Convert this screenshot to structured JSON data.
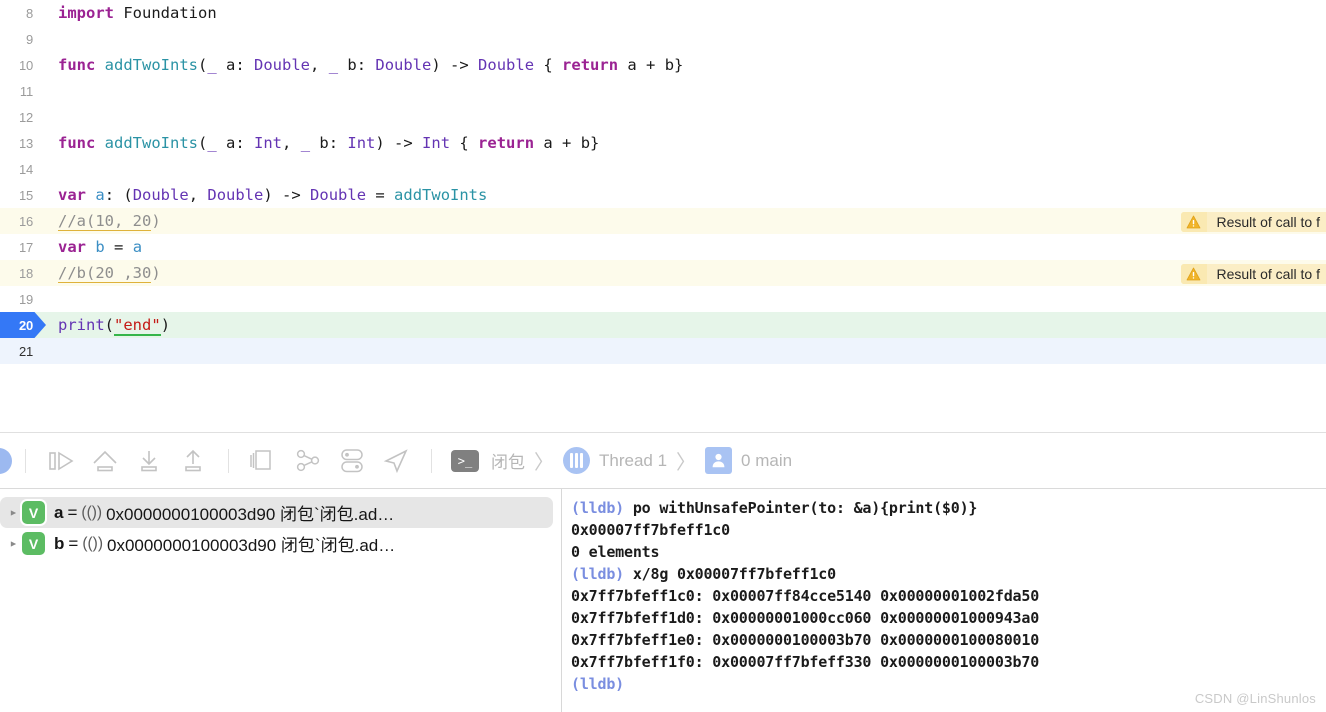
{
  "editor": {
    "lines": [
      {
        "num": "8",
        "state": "none",
        "tokens": [
          {
            "t": "kw",
            "v": "import"
          },
          {
            "t": "plain",
            "v": " Foundation"
          }
        ]
      },
      {
        "num": "9",
        "state": "none",
        "tokens": []
      },
      {
        "num": "10",
        "state": "none",
        "tokens": [
          {
            "t": "kw",
            "v": "func"
          },
          {
            "t": "plain",
            "v": " "
          },
          {
            "t": "fn",
            "v": "addTwoInts"
          },
          {
            "t": "plain",
            "v": "("
          },
          {
            "t": "pl",
            "v": "_"
          },
          {
            "t": "plain",
            "v": " a: "
          },
          {
            "t": "type",
            "v": "Double"
          },
          {
            "t": "plain",
            "v": ", "
          },
          {
            "t": "pl",
            "v": "_"
          },
          {
            "t": "plain",
            "v": " b: "
          },
          {
            "t": "type",
            "v": "Double"
          },
          {
            "t": "plain",
            "v": ") -> "
          },
          {
            "t": "type",
            "v": "Double"
          },
          {
            "t": "plain",
            "v": " { "
          },
          {
            "t": "kw",
            "v": "return"
          },
          {
            "t": "plain",
            "v": " a + b}"
          }
        ]
      },
      {
        "num": "11",
        "state": "none",
        "tokens": []
      },
      {
        "num": "12",
        "state": "none",
        "tokens": []
      },
      {
        "num": "13",
        "state": "none",
        "tokens": [
          {
            "t": "kw",
            "v": "func"
          },
          {
            "t": "plain",
            "v": " "
          },
          {
            "t": "fn",
            "v": "addTwoInts"
          },
          {
            "t": "plain",
            "v": "("
          },
          {
            "t": "pl",
            "v": "_"
          },
          {
            "t": "plain",
            "v": " a: "
          },
          {
            "t": "type",
            "v": "Int"
          },
          {
            "t": "plain",
            "v": ", "
          },
          {
            "t": "pl",
            "v": "_"
          },
          {
            "t": "plain",
            "v": " b: "
          },
          {
            "t": "type",
            "v": "Int"
          },
          {
            "t": "plain",
            "v": ") -> "
          },
          {
            "t": "type",
            "v": "Int"
          },
          {
            "t": "plain",
            "v": " { "
          },
          {
            "t": "kw",
            "v": "return"
          },
          {
            "t": "plain",
            "v": " a + b}"
          }
        ]
      },
      {
        "num": "14",
        "state": "none",
        "tokens": []
      },
      {
        "num": "15",
        "state": "none",
        "tokens": [
          {
            "t": "kw",
            "v": "var"
          },
          {
            "t": "plain",
            "v": " "
          },
          {
            "t": "var-nm",
            "v": "a"
          },
          {
            "t": "plain",
            "v": ": ("
          },
          {
            "t": "type",
            "v": "Double"
          },
          {
            "t": "plain",
            "v": ", "
          },
          {
            "t": "type",
            "v": "Double"
          },
          {
            "t": "plain",
            "v": ") -> "
          },
          {
            "t": "type",
            "v": "Double"
          },
          {
            "t": "plain",
            "v": " = "
          },
          {
            "t": "fn",
            "v": "addTwoInts"
          }
        ]
      },
      {
        "num": "16",
        "state": "warn",
        "tokens": [
          {
            "t": "cmt cmt-ul",
            "v": "//a(10, 20"
          },
          {
            "t": "cmt",
            "v": ")"
          }
        ],
        "warning": "Result of call to f"
      },
      {
        "num": "17",
        "state": "none",
        "tokens": [
          {
            "t": "kw",
            "v": "var"
          },
          {
            "t": "plain",
            "v": " "
          },
          {
            "t": "var-nm",
            "v": "b"
          },
          {
            "t": "plain",
            "v": " = "
          },
          {
            "t": "var-nm",
            "v": "a"
          }
        ]
      },
      {
        "num": "18",
        "state": "warn",
        "tokens": [
          {
            "t": "cmt cmt-ul",
            "v": "//b(20 ,30"
          },
          {
            "t": "cmt",
            "v": ")"
          }
        ],
        "warning": "Result of call to f"
      },
      {
        "num": "19",
        "state": "none",
        "tokens": []
      },
      {
        "num": "20",
        "state": "exec",
        "tokens": [
          {
            "t": "pl",
            "v": "print"
          },
          {
            "t": "plain",
            "v": "("
          },
          {
            "t": "str str-underline",
            "v": "\"end\""
          },
          {
            "t": "plain",
            "v": ")"
          }
        ]
      },
      {
        "num": "21",
        "state": "current",
        "tokens": []
      }
    ]
  },
  "debugbar": {
    "buttons": [
      {
        "name": "continue-button",
        "label": "Continue"
      },
      {
        "name": "step-over-button",
        "label": "Step Over"
      },
      {
        "name": "step-into-button",
        "label": "Step Into"
      },
      {
        "name": "step-out-button",
        "label": "Step Out"
      },
      {
        "name": "view-hierarchy-button",
        "label": "Debug View Hierarchy"
      },
      {
        "name": "memory-graph-button",
        "label": "Debug Memory Graph"
      },
      {
        "name": "environment-overrides-button",
        "label": "Environment Overrides"
      },
      {
        "name": "simulate-location-button",
        "label": "Simulate Location"
      },
      {
        "name": "console-toggle-button",
        "label": "Console"
      }
    ],
    "console_glyph": ">_",
    "breadcrumb": {
      "process": "闭包",
      "thread": "Thread 1",
      "frame": "0 main",
      "separator": "〉"
    }
  },
  "variables": {
    "rows": [
      {
        "name": "a",
        "equals": "=",
        "type": "(())",
        "value": "0x0000000100003d90 闭包`闭包.ad…",
        "badge": "V",
        "selected": true,
        "expanded": false
      },
      {
        "name": "b",
        "equals": "=",
        "type": "(())",
        "value": "0x0000000100003d90 闭包`闭包.ad…",
        "badge": "V",
        "selected": false,
        "expanded": false
      }
    ]
  },
  "console": {
    "lines": [
      {
        "prompt": "(lldb)",
        "text": " po withUnsafePointer(to: &a){print($0)}"
      },
      {
        "prompt": "",
        "text": "0x00007ff7bfeff1c0"
      },
      {
        "prompt": "",
        "text": "0 elements"
      },
      {
        "prompt": "",
        "text": ""
      },
      {
        "prompt": "(lldb)",
        "text": " x/8g 0x00007ff7bfeff1c0"
      },
      {
        "prompt": "",
        "text": "0x7ff7bfeff1c0: 0x00007ff84cce5140 0x00000001002fda50"
      },
      {
        "prompt": "",
        "text": "0x7ff7bfeff1d0: 0x00000001000cc060 0x00000001000943a0"
      },
      {
        "prompt": "",
        "text": "0x7ff7bfeff1e0: 0x0000000100003b70 0x0000000100080010"
      },
      {
        "prompt": "",
        "text": "0x7ff7bfeff1f0: 0x00007ff7bfeff330 0x0000000100003b70"
      },
      {
        "prompt": "(lldb)",
        "text": ""
      }
    ]
  },
  "watermark": "CSDN @LinShunlos",
  "colors": {
    "keyword": "#9b2393",
    "type": "#6434b3",
    "function": "#2b93a5",
    "string": "#c41a16",
    "comment": "#8e8e8e",
    "exec_line_bg": "#e6f5e9",
    "warn_line_bg": "#fdfbeb",
    "current_line_bg": "#eef4fd",
    "warning_badge": "#fae9b2",
    "accent_blue": "#3478f6",
    "var_badge_green": "#5cbc63"
  }
}
